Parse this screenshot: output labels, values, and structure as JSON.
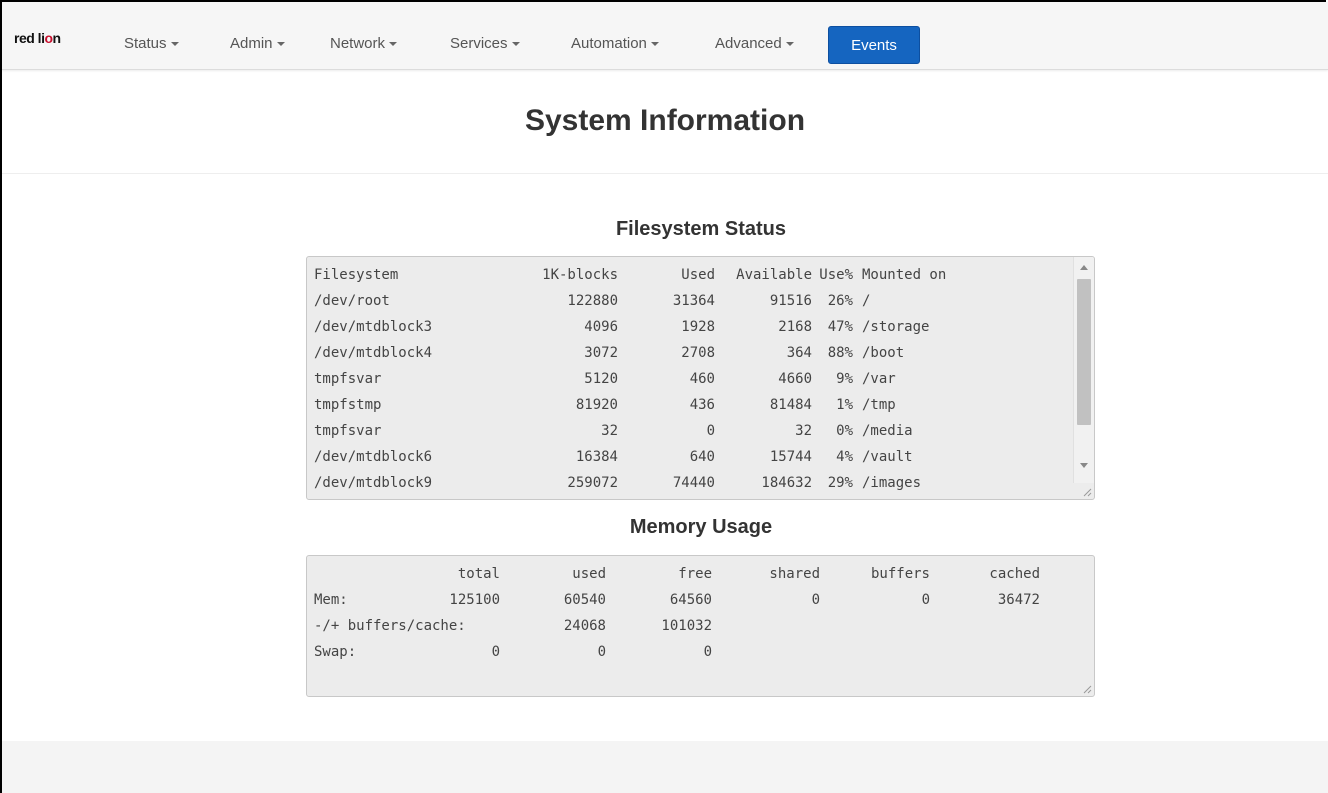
{
  "nav": {
    "logo_text_a": "red li",
    "logo_text_b": "n",
    "logo_o": "o",
    "items": [
      {
        "label": "Status"
      },
      {
        "label": "Admin"
      },
      {
        "label": "Network"
      },
      {
        "label": "Services"
      },
      {
        "label": "Automation"
      },
      {
        "label": "Advanced"
      }
    ],
    "active_item": "Events",
    "active_color": "#1565c0"
  },
  "page": {
    "title": "System Information"
  },
  "filesystem": {
    "title": "Filesystem Status",
    "headers": [
      "Filesystem",
      "1K-blocks",
      "Used",
      "Available",
      "Use%",
      "Mounted on"
    ],
    "rows": [
      [
        "/dev/root",
        "122880",
        "31364",
        "91516",
        "26%",
        "/"
      ],
      [
        "/dev/mtdblock3",
        "4096",
        "1928",
        "2168",
        "47%",
        "/storage"
      ],
      [
        "/dev/mtdblock4",
        "3072",
        "2708",
        "364",
        "88%",
        "/boot"
      ],
      [
        "tmpfsvar",
        "5120",
        "460",
        "4660",
        "9%",
        "/var"
      ],
      [
        "tmpfstmp",
        "81920",
        "436",
        "81484",
        "1%",
        "/tmp"
      ],
      [
        "tmpfsvar",
        "32",
        "0",
        "32",
        "0%",
        "/media"
      ],
      [
        "/dev/mtdblock6",
        "16384",
        "640",
        "15744",
        "4%",
        "/vault"
      ],
      [
        "/dev/mtdblock9",
        "259072",
        "74440",
        "184632",
        "29%",
        "/images"
      ]
    ]
  },
  "memory": {
    "title": "Memory Usage",
    "headers": [
      "",
      "total",
      "used",
      "free",
      "shared",
      "buffers",
      "cached"
    ],
    "rows": [
      [
        "Mem:",
        "125100",
        "60540",
        "64560",
        "0",
        "0",
        "36472"
      ],
      [
        "-/+ buffers/cache:",
        "",
        "24068",
        "101032",
        "",
        "",
        ""
      ],
      [
        "Swap:",
        "0",
        "0",
        "0",
        "",
        "",
        ""
      ]
    ]
  }
}
